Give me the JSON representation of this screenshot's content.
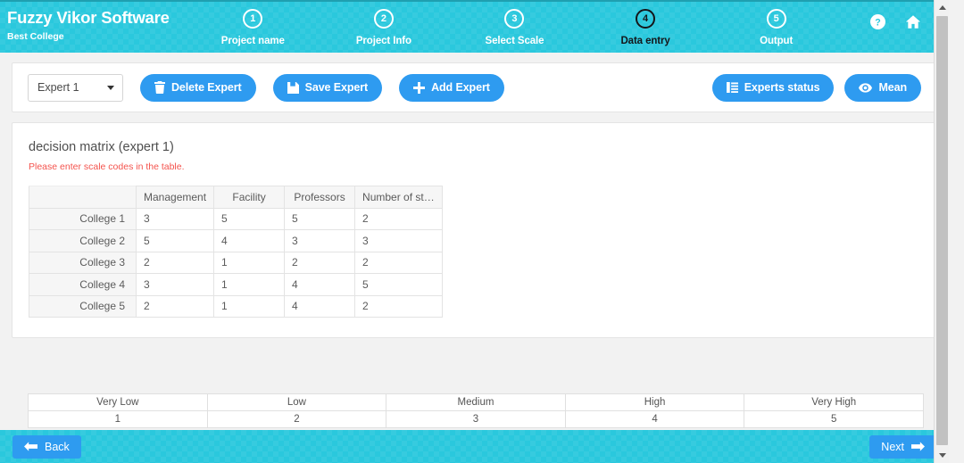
{
  "header": {
    "brand_title": "Fuzzy Vikor Software",
    "brand_subtitle": "Best College",
    "steps": [
      {
        "number": "1",
        "label": "Project name"
      },
      {
        "number": "2",
        "label": "Project Info"
      },
      {
        "number": "3",
        "label": "Select Scale"
      },
      {
        "number": "4",
        "label": "Data entry"
      },
      {
        "number": "5",
        "label": "Output"
      }
    ],
    "active_step": 4,
    "help_icon": "question-circle-icon",
    "home_icon": "home-icon"
  },
  "toolbar": {
    "expert_select_value": "Expert 1",
    "delete_expert_label": "Delete Expert",
    "save_expert_label": "Save Expert",
    "add_expert_label": "Add Expert",
    "experts_status_label": "Experts status",
    "mean_label": "Mean"
  },
  "matrix": {
    "title": "decision matrix (expert 1)",
    "warning": "Please enter scale codes in the table.",
    "corner_header": "",
    "columns": [
      "Management",
      "Facility",
      "Professors",
      "Number of st…"
    ],
    "rows": [
      {
        "name": "College 1",
        "values": [
          "3",
          "5",
          "5",
          "2"
        ]
      },
      {
        "name": "College 2",
        "values": [
          "5",
          "4",
          "3",
          "3"
        ]
      },
      {
        "name": "College 3",
        "values": [
          "2",
          "1",
          "2",
          "2"
        ]
      },
      {
        "name": "College 4",
        "values": [
          "3",
          "1",
          "4",
          "5"
        ]
      },
      {
        "name": "College 5",
        "values": [
          "2",
          "1",
          "4",
          "2"
        ]
      }
    ]
  },
  "scale_legend": {
    "labels": [
      "Very Low",
      "Low",
      "Medium",
      "High",
      "Very High"
    ],
    "codes": [
      "1",
      "2",
      "3",
      "4",
      "5"
    ]
  },
  "footer": {
    "back_label": "Back",
    "next_label": "Next"
  },
  "colors": {
    "header_cyan": "#2ac8dd",
    "button_blue": "#2e9bf0",
    "warning_red": "#f4534d",
    "table_header_gray": "#f6f6f6"
  }
}
